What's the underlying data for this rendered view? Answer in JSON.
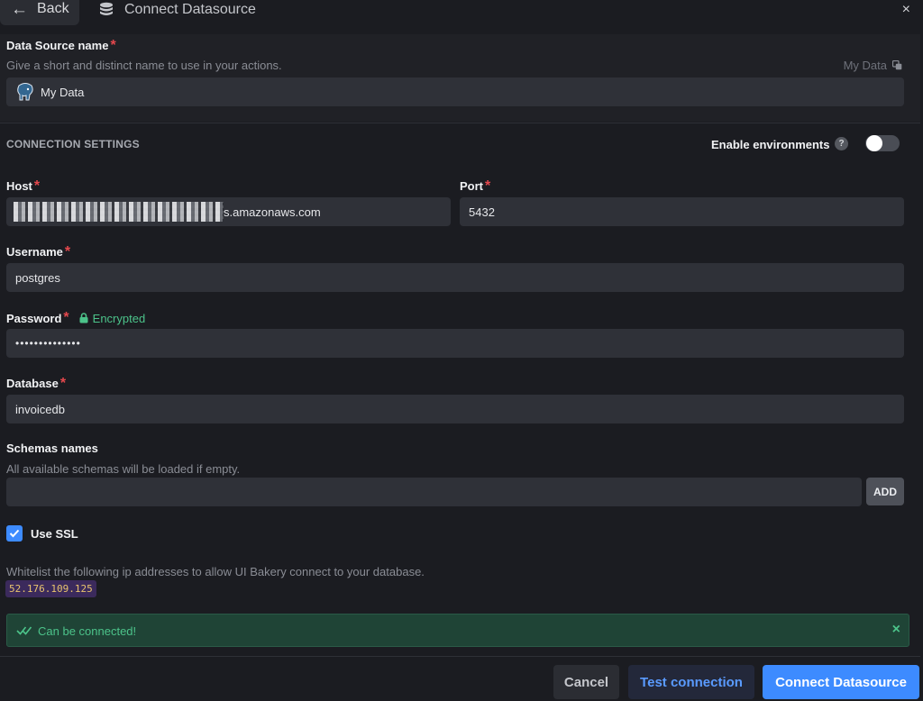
{
  "header": {
    "back_label": "Back",
    "title": "Connect Datasource",
    "close_symbol": "×"
  },
  "name_section": {
    "label": "Data Source name",
    "hint": "Give a short and distinct name to use in your actions.",
    "preview_text": "My Data",
    "value": "My Data",
    "db_icon": "postgresql-elephant-icon"
  },
  "connection": {
    "section_title": "CONNECTION SETTINGS",
    "enable_env_label": "Enable environments",
    "help_symbol": "?",
    "enable_env_on": false
  },
  "host": {
    "label": "Host",
    "value_suffix": "s.amazonaws.com"
  },
  "port": {
    "label": "Port",
    "value": "5432"
  },
  "username": {
    "label": "Username",
    "value": "postgres"
  },
  "password": {
    "label": "Password",
    "encrypted_label": "Encrypted",
    "value": "••••••••••••••"
  },
  "database": {
    "label": "Database",
    "value": "invoicedb"
  },
  "schemas": {
    "label": "Schemas names",
    "hint": "All available schemas will be loaded if empty.",
    "value": "",
    "add_label": "ADD"
  },
  "ssl": {
    "label": "Use SSL",
    "checked": true
  },
  "whitelist": {
    "text": "Whitelist the following ip addresses to allow UI Bakery connect to your database.",
    "ip": "52.176.109.125"
  },
  "status": {
    "message": "Can be connected!",
    "close_symbol": "×"
  },
  "footer": {
    "cancel_label": "Cancel",
    "test_label": "Test connection",
    "connect_label": "Connect Datasource"
  },
  "colors": {
    "primary": "#3d8bff",
    "success_bg": "#1f4436",
    "success_text": "#4cc38a",
    "required": "#e5484d"
  }
}
